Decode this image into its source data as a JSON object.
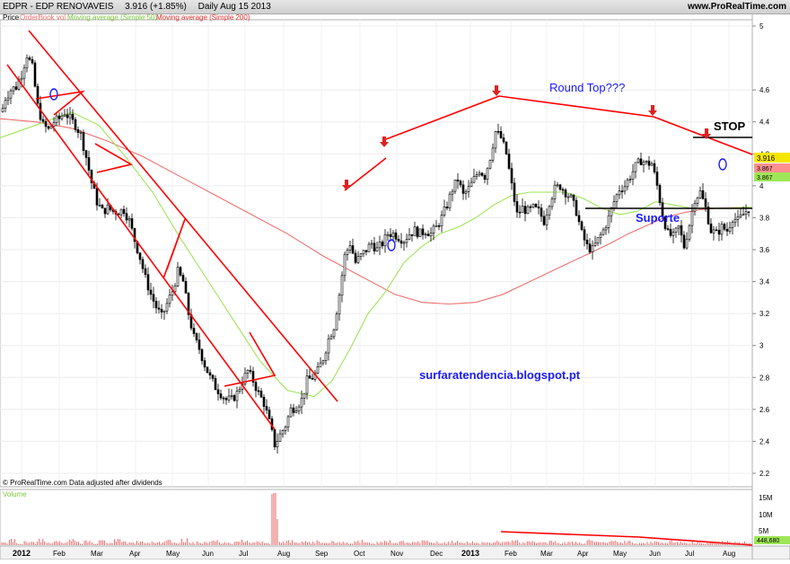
{
  "header": {
    "symbol": "EDPR - EDP RENOVAVEIS",
    "quote": "3.916 (+1.85%)",
    "period": "Daily",
    "date": "Aug 15 2013",
    "site": "www.ProRealTime.com"
  },
  "legend": {
    "price": "Price",
    "orderbook": "OrderBook vol",
    "ma50": "Moving average (Simple 50)",
    "ma200": "Moving average (Simple 200)"
  },
  "annotations": {
    "round_top": "Round Top???",
    "stop": "STOP",
    "suporte": "Suporte",
    "blog": "surfaratendencia.blogspot.pt",
    "credit": "© ProRealTime.com  Data adjusted after dividends"
  },
  "volume_panel": {
    "label": "Volume",
    "ticks": [
      "15M",
      "10M",
      "5M"
    ],
    "last_value": "448,680"
  },
  "colors": {
    "candle": "#000000",
    "ma50": "#9ee657",
    "ma200": "#f07070",
    "drawing": "#ff0000",
    "annotation_text": "#1a1aff",
    "price_label_bg": "#f5e600",
    "ma50_label_bg": "#9ee657",
    "ma200_label_bg": "#ff9090"
  },
  "chart_data": {
    "type": "candlestick",
    "y_axis": {
      "min": 2.15,
      "max": 5.0,
      "ticks": [
        "5",
        "4.6",
        "4.4",
        "4.2",
        "4",
        "3.8",
        "3.6",
        "3.4",
        "3.2",
        "3",
        "2.8",
        "2.6",
        "2.4",
        "2.2"
      ]
    },
    "x_axis": {
      "labels": [
        "2012",
        "Feb",
        "Mar",
        "Apr",
        "May",
        "Jun",
        "Jul",
        "Aug",
        "Sep",
        "Oct",
        "Nov",
        "Dec",
        "2013",
        "Feb",
        "Mar",
        "Apr",
        "May",
        "Jun",
        "Jul",
        "Aug"
      ]
    },
    "last_price": "3.916",
    "ma50_last": "3.867",
    "ma200_last": "3.867",
    "price_path": [
      [
        0,
        4.42
      ],
      [
        6,
        4.55
      ],
      [
        12,
        4.6
      ],
      [
        18,
        4.62
      ],
      [
        24,
        4.7
      ],
      [
        30,
        4.82
      ],
      [
        36,
        4.74
      ],
      [
        42,
        4.5
      ],
      [
        48,
        4.38
      ],
      [
        54,
        4.35
      ],
      [
        60,
        4.4
      ],
      [
        66,
        4.42
      ],
      [
        72,
        4.46
      ],
      [
        78,
        4.42
      ],
      [
        84,
        4.38
      ],
      [
        90,
        4.32
      ],
      [
        96,
        4.18
      ],
      [
        102,
        4.02
      ],
      [
        108,
        3.9
      ],
      [
        114,
        3.84
      ],
      [
        120,
        3.86
      ],
      [
        126,
        3.84
      ],
      [
        132,
        3.84
      ],
      [
        138,
        3.85
      ],
      [
        144,
        3.78
      ],
      [
        150,
        3.66
      ],
      [
        156,
        3.55
      ],
      [
        162,
        3.42
      ],
      [
        168,
        3.32
      ],
      [
        174,
        3.24
      ],
      [
        180,
        3.18
      ],
      [
        186,
        3.26
      ],
      [
        192,
        3.34
      ],
      [
        198,
        3.46
      ],
      [
        204,
        3.4
      ],
      [
        210,
        3.2
      ],
      [
        216,
        3.05
      ],
      [
        222,
        2.98
      ],
      [
        228,
        2.88
      ],
      [
        234,
        2.8
      ],
      [
        240,
        2.74
      ],
      [
        246,
        2.7
      ],
      [
        252,
        2.66
      ],
      [
        258,
        2.66
      ],
      [
        264,
        2.7
      ],
      [
        270,
        2.78
      ],
      [
        276,
        2.84
      ],
      [
        282,
        2.78
      ],
      [
        288,
        2.7
      ],
      [
        294,
        2.64
      ],
      [
        300,
        2.52
      ],
      [
        306,
        2.38
      ],
      [
        312,
        2.44
      ],
      [
        318,
        2.5
      ],
      [
        324,
        2.6
      ],
      [
        330,
        2.62
      ],
      [
        336,
        2.66
      ],
      [
        342,
        2.78
      ],
      [
        348,
        2.8
      ],
      [
        354,
        2.84
      ],
      [
        360,
        2.92
      ],
      [
        366,
        3.04
      ],
      [
        372,
        3.12
      ],
      [
        378,
        3.32
      ],
      [
        384,
        3.56
      ],
      [
        390,
        3.64
      ],
      [
        396,
        3.52
      ],
      [
        402,
        3.56
      ],
      [
        408,
        3.6
      ],
      [
        414,
        3.64
      ],
      [
        420,
        3.6
      ],
      [
        426,
        3.64
      ],
      [
        432,
        3.7
      ],
      [
        438,
        3.7
      ],
      [
        444,
        3.68
      ],
      [
        450,
        3.66
      ],
      [
        456,
        3.7
      ],
      [
        462,
        3.72
      ],
      [
        468,
        3.7
      ],
      [
        474,
        3.72
      ],
      [
        480,
        3.7
      ],
      [
        486,
        3.74
      ],
      [
        492,
        3.8
      ],
      [
        498,
        3.88
      ],
      [
        504,
        3.98
      ],
      [
        510,
        4.04
      ],
      [
        516,
        3.94
      ],
      [
        522,
        3.98
      ],
      [
        528,
        4.04
      ],
      [
        534,
        4.1
      ],
      [
        540,
        4.06
      ],
      [
        546,
        4.18
      ],
      [
        552,
        4.34
      ],
      [
        558,
        4.3
      ],
      [
        564,
        4.2
      ],
      [
        570,
        4.0
      ],
      [
        576,
        3.82
      ],
      [
        582,
        3.86
      ],
      [
        588,
        3.84
      ],
      [
        594,
        3.86
      ],
      [
        600,
        3.84
      ],
      [
        606,
        3.78
      ],
      [
        612,
        3.9
      ],
      [
        618,
        3.98
      ],
      [
        624,
        4.0
      ],
      [
        630,
        3.96
      ],
      [
        636,
        3.92
      ],
      [
        642,
        3.84
      ],
      [
        648,
        3.7
      ],
      [
        654,
        3.62
      ],
      [
        660,
        3.6
      ],
      [
        666,
        3.66
      ],
      [
        672,
        3.72
      ],
      [
        678,
        3.8
      ],
      [
        684,
        3.9
      ],
      [
        690,
        3.98
      ],
      [
        696,
        4.0
      ],
      [
        702,
        4.06
      ],
      [
        708,
        4.12
      ],
      [
        714,
        4.16
      ],
      [
        720,
        4.14
      ],
      [
        726,
        4.14
      ],
      [
        732,
        4.0
      ],
      [
        738,
        3.82
      ],
      [
        744,
        3.7
      ],
      [
        750,
        3.68
      ],
      [
        756,
        3.74
      ],
      [
        762,
        3.62
      ],
      [
        768,
        3.76
      ],
      [
        774,
        3.92
      ],
      [
        780,
        3.96
      ],
      [
        786,
        3.86
      ],
      [
        792,
        3.72
      ],
      [
        798,
        3.7
      ],
      [
        804,
        3.74
      ],
      [
        810,
        3.72
      ],
      [
        816,
        3.8
      ],
      [
        822,
        3.78
      ],
      [
        828,
        3.82
      ],
      [
        834,
        3.86
      ],
      [
        838,
        3.916
      ]
    ],
    "ma50_path": [
      [
        0,
        4.3
      ],
      [
        40,
        4.38
      ],
      [
        80,
        4.46
      ],
      [
        110,
        4.38
      ],
      [
        140,
        4.18
      ],
      [
        170,
        3.96
      ],
      [
        200,
        3.68
      ],
      [
        230,
        3.42
      ],
      [
        260,
        3.16
      ],
      [
        290,
        2.9
      ],
      [
        320,
        2.72
      ],
      [
        350,
        2.68
      ],
      [
        370,
        2.78
      ],
      [
        390,
        2.98
      ],
      [
        410,
        3.2
      ],
      [
        430,
        3.34
      ],
      [
        450,
        3.52
      ],
      [
        470,
        3.62
      ],
      [
        490,
        3.7
      ],
      [
        510,
        3.74
      ],
      [
        530,
        3.8
      ],
      [
        550,
        3.88
      ],
      [
        570,
        3.94
      ],
      [
        590,
        3.96
      ],
      [
        610,
        3.96
      ],
      [
        630,
        3.96
      ],
      [
        650,
        3.92
      ],
      [
        670,
        3.86
      ],
      [
        690,
        3.82
      ],
      [
        710,
        3.84
      ],
      [
        730,
        3.9
      ],
      [
        750,
        3.88
      ],
      [
        770,
        3.86
      ],
      [
        790,
        3.86
      ],
      [
        810,
        3.86
      ],
      [
        838,
        3.867
      ]
    ],
    "ma200_path": [
      [
        0,
        4.42
      ],
      [
        40,
        4.4
      ],
      [
        80,
        4.36
      ],
      [
        120,
        4.28
      ],
      [
        160,
        4.18
      ],
      [
        200,
        4.06
      ],
      [
        240,
        3.94
      ],
      [
        280,
        3.82
      ],
      [
        320,
        3.7
      ],
      [
        360,
        3.56
      ],
      [
        400,
        3.44
      ],
      [
        440,
        3.32
      ],
      [
        470,
        3.27
      ],
      [
        500,
        3.26
      ],
      [
        530,
        3.27
      ],
      [
        560,
        3.32
      ],
      [
        590,
        3.4
      ],
      [
        620,
        3.48
      ],
      [
        650,
        3.56
      ],
      [
        680,
        3.64
      ],
      [
        700,
        3.7
      ],
      [
        720,
        3.75
      ],
      [
        740,
        3.8
      ],
      [
        760,
        3.83
      ],
      [
        780,
        3.85
      ],
      [
        800,
        3.86
      ],
      [
        838,
        3.867
      ]
    ],
    "volume_bars": [
      0.05,
      0.1,
      0.04,
      0.08,
      0.06,
      0.12,
      0.04,
      0.07,
      0.05,
      0.1,
      0.06,
      0.08,
      0.05,
      0.09,
      0.04,
      0.11,
      0.06,
      0.05,
      0.08,
      0.04,
      0.07,
      0.06,
      0.09,
      0.05,
      0.12,
      0.05,
      0.07,
      0.06,
      0.08,
      0.05,
      0.04,
      0.06,
      0.1,
      0.05,
      0.07,
      0.04,
      0.95,
      0.06,
      0.08,
      0.05,
      0.07,
      0.06,
      0.09,
      0.04,
      0.08,
      0.06,
      0.05,
      0.07,
      0.1,
      0.05,
      0.06,
      0.08,
      0.04,
      0.07,
      0.05,
      0.06,
      0.09,
      0.05,
      0.07,
      0.06,
      0.08,
      0.05,
      0.07,
      0.04,
      0.06,
      0.05,
      0.08,
      0.06,
      0.09,
      0.05,
      0.07,
      0.06,
      0.05,
      0.08,
      0.04,
      0.06,
      0.07,
      0.05,
      0.09,
      0.06,
      0.05,
      0.07,
      0.06,
      0.08,
      0.05,
      0.04,
      0.06,
      0.07,
      0.05,
      0.08,
      0.06,
      0.05,
      0.07,
      0.04,
      0.06,
      0.05,
      0.08,
      0.06,
      0.05,
      0.07
    ]
  }
}
